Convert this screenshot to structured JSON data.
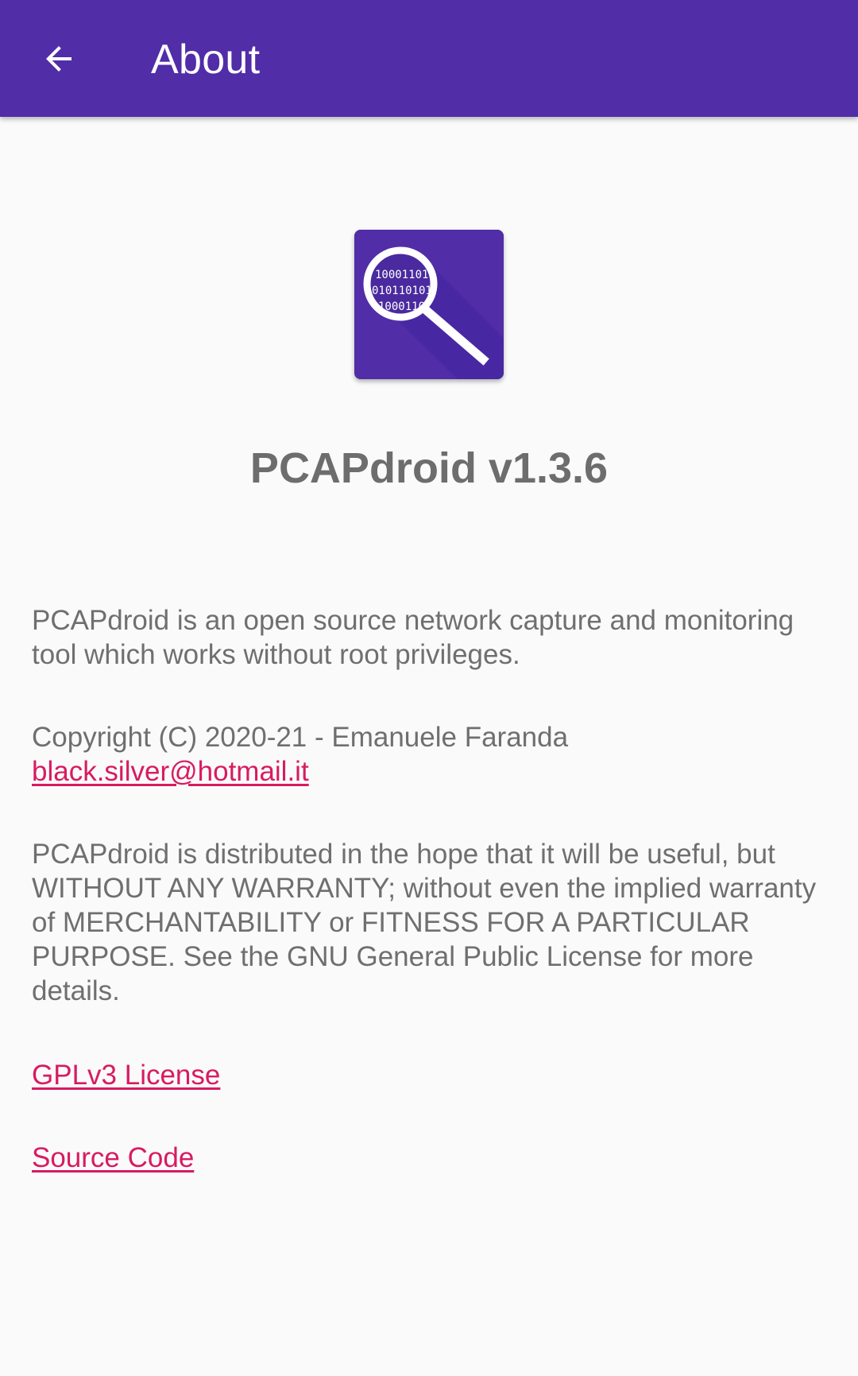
{
  "app_bar": {
    "title": "About",
    "back_icon": "arrow-back-icon",
    "background_color": "#512da8"
  },
  "logo": {
    "icon": "magnifier-binary-icon",
    "binary_lines": [
      "10001101",
      "010110101",
      "1000110"
    ]
  },
  "app_name": "PCAPdroid v1.3.6",
  "description": "PCAPdroid is an open source network capture and monitoring tool which works without root privileges.",
  "copyright": {
    "text": "Copyright (C) 2020-21 - Emanuele Faranda",
    "email": "black.silver@hotmail.it"
  },
  "warranty": "PCAPdroid is distributed in the hope that it will be useful, but WITHOUT ANY WARRANTY; without even the implied warranty of MERCHANTABILITY or FITNESS FOR A PARTICULAR PURPOSE. See the GNU General Public License for more details.",
  "links": {
    "license": "GPLv3 License",
    "source": "Source Code",
    "color": "#d81b60"
  }
}
